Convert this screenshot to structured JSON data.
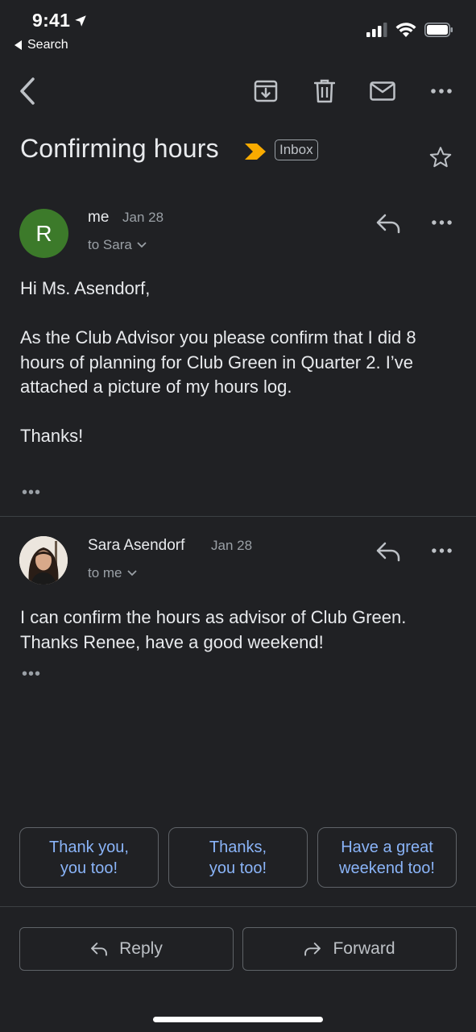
{
  "status_bar": {
    "time": "9:41",
    "back_app_label": "Search",
    "icons": [
      "location-arrow-icon",
      "cellular-signal-icon",
      "wifi-icon",
      "battery-icon"
    ]
  },
  "toolbar": {
    "icons": [
      "back-arrow-icon",
      "archive-icon",
      "trash-icon",
      "mail-unread-icon",
      "more-horizontal-icon"
    ]
  },
  "subject": {
    "title": "Confirming hours",
    "label": "Inbox",
    "important_color": "#f9ab00"
  },
  "messages": [
    {
      "avatar_letter": "R",
      "avatar_color": "#3c7a2a",
      "sender": "me",
      "date": "Jan 28",
      "to_line": "to Sara",
      "body": "Hi Ms. Asendorf,\n\nAs the Club Advisor you please confirm that I did 8 hours of planning for Club Green in Quarter 2. I’ve attached a picture of my hours log.\n\nThanks!",
      "ellipsis": "•••"
    },
    {
      "sender": "Sara Asendorf",
      "date": "Jan 28",
      "to_line": "to me",
      "body": "I can confirm the hours as advisor of Club Green. Thanks Renee, have a good weekend!",
      "ellipsis": "•••"
    }
  ],
  "smart_replies": [
    "Thank you,\nyou too!",
    "Thanks,\nyou too!",
    "Have a great\nweekend too!"
  ],
  "actions": {
    "reply_label": "Reply",
    "forward_label": "Forward"
  },
  "colors": {
    "background": "#202124",
    "accent_link": "#8ab4f8"
  }
}
